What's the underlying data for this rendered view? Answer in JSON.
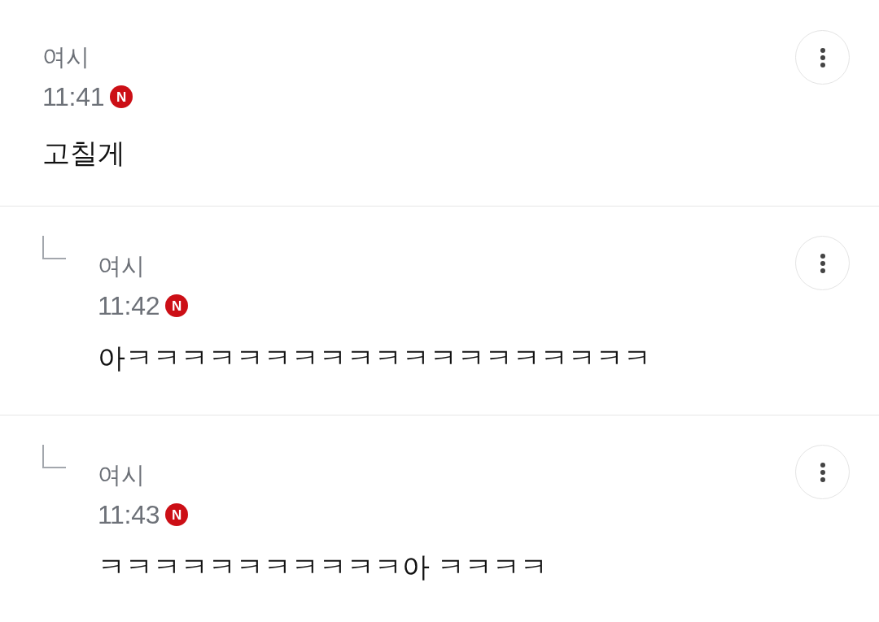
{
  "comments": [
    {
      "kind": "comment",
      "author": "여시",
      "time": "11:41",
      "badge": "N",
      "content": "고칠게"
    },
    {
      "kind": "reply",
      "author": "여시",
      "time": "11:42",
      "badge": "N",
      "content": "아ㅋㅋㅋㅋㅋㅋㅋㅋㅋㅋㅋㅋㅋㅋㅋㅋㅋㅋㅋ"
    },
    {
      "kind": "reply",
      "author": "여시",
      "time": "11:43",
      "badge": "N",
      "content": "ㅋㅋㅋㅋㅋㅋㅋㅋㅋㅋㅋ아 ㅋㅋㅋㅋ"
    }
  ]
}
